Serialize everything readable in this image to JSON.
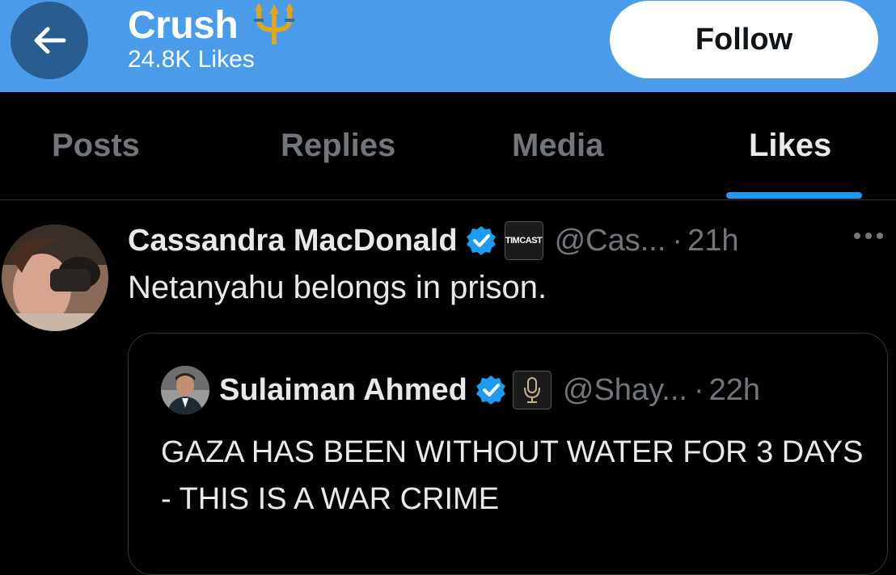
{
  "header": {
    "title": "Crush",
    "title_emoji": "trident-emoji",
    "subtitle": "24.8K Likes",
    "follow_label": "Follow",
    "back_icon": "arrow-left-icon",
    "bg_color": "#4a9be9"
  },
  "tabs": [
    {
      "label": "Posts",
      "active": false
    },
    {
      "label": "Replies",
      "active": false
    },
    {
      "label": "Media",
      "active": false
    },
    {
      "label": "Likes",
      "active": true
    }
  ],
  "tweet": {
    "name": "Cassandra MacDonald",
    "verified": true,
    "affiliate_badge": "TIMCAST",
    "handle": "@Cas...",
    "separator": "·",
    "time": "21h",
    "text": "Netanyahu belongs in prison.",
    "quote": {
      "name": "Sulaiman Ahmed",
      "verified": true,
      "affiliate_badge_icon": "podcast-mic-icon",
      "handle": "@Shay...",
      "separator": "·",
      "time": "22h",
      "text": "GAZA HAS BEEN WITHOUT WATER FOR 3 DAYS - THIS IS A WAR CRIME"
    }
  },
  "colors": {
    "accent": "#1d9bf0",
    "muted": "#71767b",
    "background": "#000000"
  }
}
